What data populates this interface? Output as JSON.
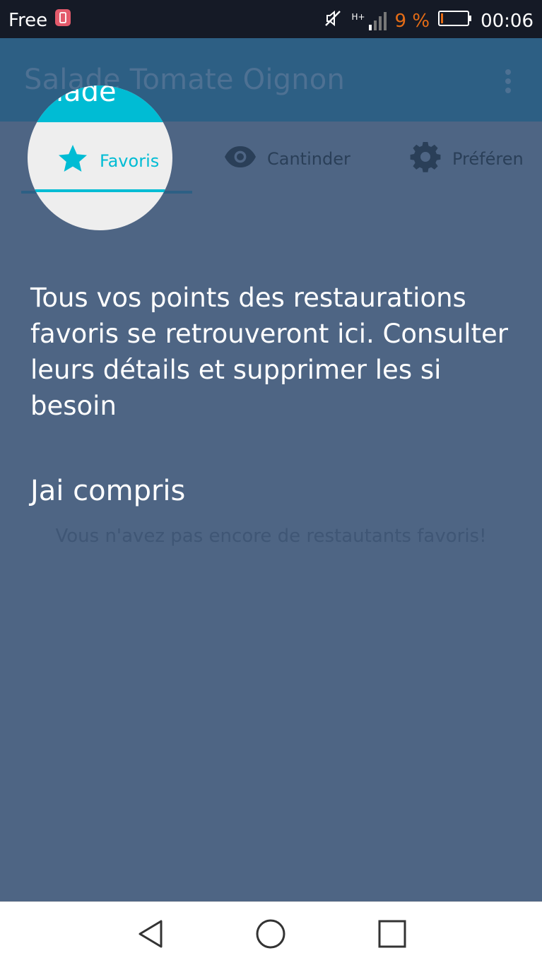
{
  "status_bar": {
    "carrier": "Free",
    "network": "H+",
    "battery_percent": "9 %",
    "time": "00:06",
    "battery_color": "#e46c16"
  },
  "app_bar": {
    "title": "Salade Tomate Oignon",
    "overflow_icon": "more-vert-icon"
  },
  "tabs": [
    {
      "label": "Favoris",
      "icon": "star-icon",
      "selected": true
    },
    {
      "label": "Cantinder",
      "icon": "eye-icon",
      "selected": false
    },
    {
      "label": "Préféren",
      "icon": "gear-icon",
      "selected": false
    }
  ],
  "main": {
    "empty_message": "Vous n'avez pas encore de restautants favoris!"
  },
  "tutorial": {
    "text": "Tous vos points des restaurations favoris se retrouveront ici. Consulter leurs détails et supprimer les si besoin",
    "action": "Jai compris",
    "accent": "#00bcd4"
  },
  "nav_bar": {
    "buttons": [
      "back-icon",
      "home-icon",
      "recents-icon"
    ]
  }
}
